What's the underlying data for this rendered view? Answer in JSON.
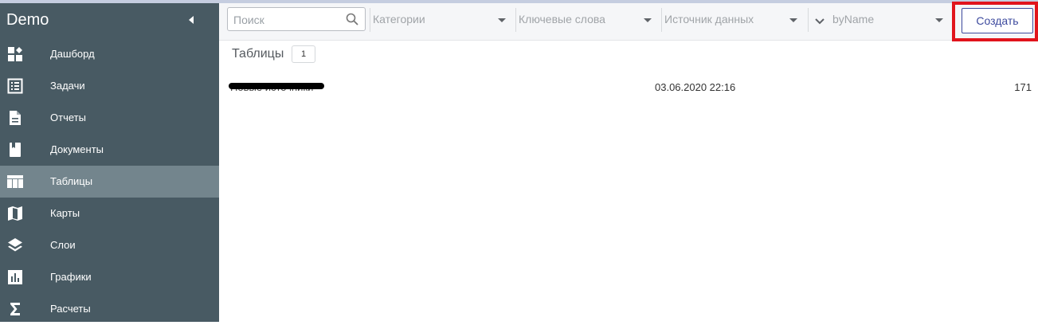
{
  "app": {
    "title": "Demo"
  },
  "colors": {
    "sidebar_bg": "#485a63",
    "sidebar_active": "#73858d",
    "accent": "#3d4a9e",
    "highlight": "#e1141c"
  },
  "sidebar": {
    "items": [
      {
        "label": "Дашборд",
        "icon": "dashboard-icon"
      },
      {
        "label": "Задачи",
        "icon": "tasks-list-icon"
      },
      {
        "label": "Отчеты",
        "icon": "report-document-icon"
      },
      {
        "label": "Документы",
        "icon": "book-icon"
      },
      {
        "label": "Таблицы",
        "icon": "table-icon",
        "active": true
      },
      {
        "label": "Карты",
        "icon": "map-icon"
      },
      {
        "label": "Слои",
        "icon": "layers-icon"
      },
      {
        "label": "Графики",
        "icon": "bar-chart-icon"
      },
      {
        "label": "Расчеты",
        "icon": "sigma-icon"
      }
    ]
  },
  "toolbar": {
    "search_placeholder": "Поиск",
    "filters": {
      "categories": "Категории",
      "keywords": "Ключевые слова",
      "data_source": "Источник данных",
      "sort": "byName"
    },
    "create_label": "Создать"
  },
  "main": {
    "section_title": "Таблицы",
    "count": "1",
    "rows": [
      {
        "name": "Новые источники",
        "date": "03.06.2020 22:16",
        "count": "171"
      }
    ]
  }
}
